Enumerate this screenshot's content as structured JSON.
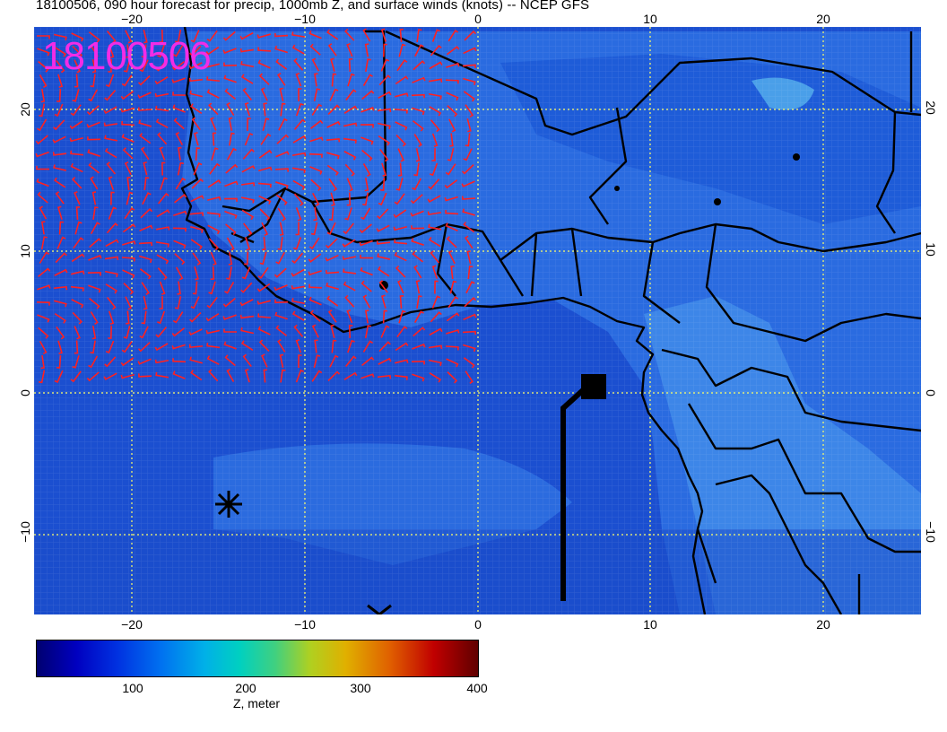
{
  "title": "18100506, 090 hour forecast for precip, 1000mb Z, and surface winds (knots) -- NCEP GFS",
  "stamp": "18100506",
  "lon_ticks": [
    "−20",
    "−10",
    "0",
    "10",
    "20"
  ],
  "lat_ticks": [
    "20",
    "10",
    "0",
    "−10"
  ],
  "colorbar": {
    "label": "Z, meter",
    "ticks": [
      "100",
      "200",
      "300",
      "400"
    ]
  },
  "colors": {
    "ocean_base": "#1b4fd0",
    "land_base": "#2a6be0",
    "grid": "#ffff66",
    "wind_barbs": "#ff2020",
    "stamp": "#f22ce6",
    "coast": "#000000"
  }
}
